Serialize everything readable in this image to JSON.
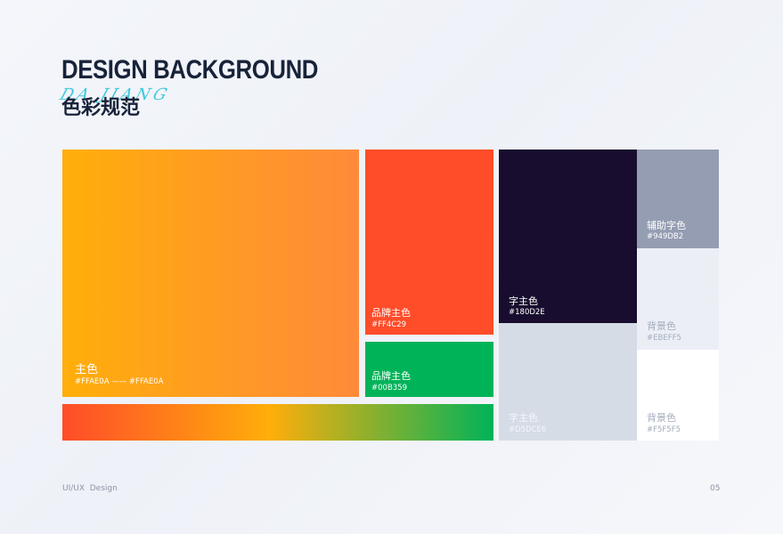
{
  "header": {
    "title": "DESIGN BACKGROUND",
    "subtitle": "色彩规范",
    "script_text": "DA JIANG"
  },
  "colors": {
    "primary": {
      "label": "主色",
      "hex_text": "#FFAE0A —— #FFAE0A",
      "gradient_from": "#FFAE0A",
      "gradient_to": "#FF8A3A"
    },
    "brand_red": {
      "label": "品牌主色",
      "hex": "#FF4C29",
      "color": "#FF4C29"
    },
    "brand_green": {
      "label": "品牌主色",
      "hex": "#00B359",
      "color": "#00B359"
    },
    "text_dark": {
      "label": "字主色",
      "hex": "#180D2E",
      "color": "#180D2E"
    },
    "text_light": {
      "label": "字主色",
      "hex": "#D5DCE6",
      "color": "#D5DCE6"
    },
    "aux_text": {
      "label": "辅助字色",
      "hex": "#949DB2",
      "color": "#949DB2"
    },
    "background_1": {
      "label": "背景色",
      "hex": "#EBEFF5",
      "color": "#EBEFF5"
    },
    "background_2": {
      "label": "背景色",
      "hex": "#F5F5F5",
      "color": "#FFFFFF"
    },
    "gradient_bar": [
      "#FF4C29",
      "#FFAE0A",
      "#00B359"
    ]
  },
  "footer": {
    "left": "UI/UX  Design",
    "page": "05"
  }
}
